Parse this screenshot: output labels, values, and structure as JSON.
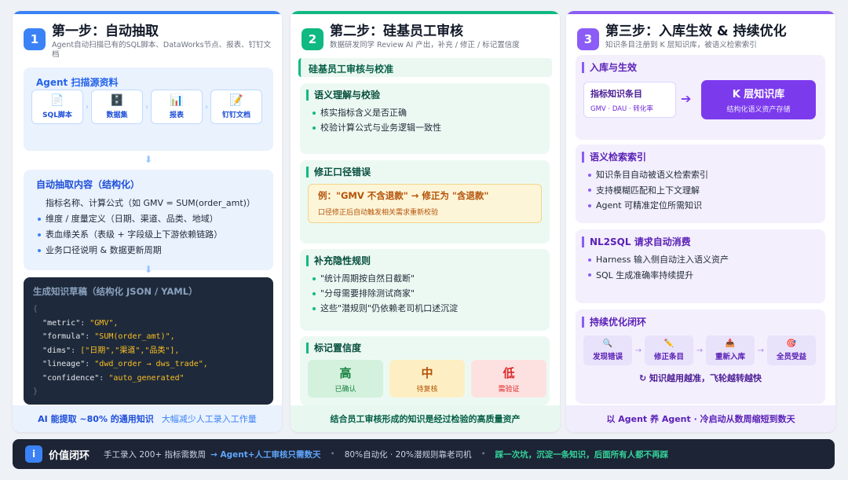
{
  "col1": {
    "num": "1",
    "title": "第一步：自动抽取",
    "subtitle": "Agent自动扫描已有的SQL脚本、DataWorks节点、报表、钉钉文档",
    "scan": {
      "title": "Agent 扫描源资料",
      "sources": [
        {
          "icon": "document-icon",
          "glyph": "📄",
          "label": "SQL脚本"
        },
        {
          "icon": "cabinet-icon",
          "glyph": "🗄️",
          "label": "数据集"
        },
        {
          "icon": "bar-chart-icon",
          "glyph": "📊",
          "label": "报表"
        },
        {
          "icon": "memo-icon",
          "glyph": "📝",
          "label": "钉钉文档"
        }
      ]
    },
    "extract": {
      "title": "自动抽取内容（结构化）",
      "items": [
        "指标名称、计算公式（如 GMV = SUM(order_amt)）",
        "维度 / 度量定义（日期、渠道、品类、地域）",
        "表血缘关系（表级 + 字段级上下游依赖链路）",
        "业务口径说明 & 数据更新周期"
      ]
    },
    "draft": {
      "title": "生成知识草稿（结构化 JSON / YAML）",
      "open_brace": "{",
      "close_brace": "}",
      "lines": [
        {
          "key": "\"metric\"",
          "value": "\"GMV\","
        },
        {
          "key": "\"formula\"",
          "value": "\"SUM(order_amt)\","
        },
        {
          "key": "\"dims\"",
          "value": "[\"日期\",\"渠道\",\"品类\"],"
        },
        {
          "key": "\"lineage\"",
          "value": "\"dwd_order → dws_trade\","
        },
        {
          "key": "\"confidence\"",
          "value": "\"auto_generated\""
        }
      ]
    },
    "footer_main": "AI 能提取 ~80% 的通用知识",
    "footer_sub": "大幅减少人工录入工作量"
  },
  "col2": {
    "num": "2",
    "title": "第二步：硅基员工审核",
    "subtitle": "数据研发同学 Review AI 产出，补充 / 修正 / 标记置信度",
    "section": "硅基员工审核与校准",
    "semantic": {
      "title": "语义理解与校验",
      "items": [
        "核实指标含义是否正确",
        "校验计算公式与业务逻辑一致性"
      ]
    },
    "fix": {
      "title": "修正口径错误",
      "example": "例：\"GMV 不含退款\" → 修正为 \"含退款\"",
      "note": "口径修正后自动触发相关需求重新校验"
    },
    "hidden": {
      "title": "补充隐性规则",
      "items": [
        "\"统计周期按自然日截断\"",
        "\"分母需要排除测试商家\"",
        "这些\"潜规则\"仍依赖老司机口述沉淀"
      ]
    },
    "confidence": {
      "title": "标记置信度",
      "levels": [
        {
          "label": "高",
          "status": "已确认",
          "color": "#15803d"
        },
        {
          "label": "中",
          "status": "待复核",
          "color": "#b45309"
        },
        {
          "label": "低",
          "status": "需验证",
          "color": "#dc2626"
        }
      ]
    },
    "footer": "结合员工审核形成的知识是经过检验的高质量资产"
  },
  "col3": {
    "num": "3",
    "title": "第三步：入库生效 & 持续优化",
    "subtitle": "知识条目注册到 K 层知识库，被语义检索索引",
    "ingest": {
      "title": "入库与生效",
      "entry_title": "指标知识条目",
      "entry_sub": "GMV · DAU · 转化率",
      "kb_title": "K 层知识库",
      "kb_sub": "结构化语义资产存储"
    },
    "search": {
      "title": "语义检索索引",
      "items": [
        "知识条目自动被语义检索索引",
        "支持模糊匹配和上下文理解",
        "Agent 可精准定位所需知识"
      ]
    },
    "nl2sql": {
      "title": "NL2SQL 请求自动消费",
      "items": [
        "Harness 输入侧自动注入语义资产",
        "SQL 生成准确率持续提升"
      ]
    },
    "loop": {
      "title": "持续优化闭环",
      "steps": [
        {
          "icon": "magnifier-icon",
          "glyph": "🔍",
          "label": "发现错误"
        },
        {
          "icon": "pencil-icon",
          "glyph": "✏️",
          "label": "修正条目"
        },
        {
          "icon": "inbox-icon",
          "glyph": "📥",
          "label": "重新入库"
        },
        {
          "icon": "target-icon",
          "glyph": "🎯",
          "label": "全员受益"
        }
      ],
      "caption": "↻ 知识越用越准，飞轮越转越快"
    },
    "footer": "以 Agent 养 Agent · 冷启动从数周缩短到数天"
  },
  "bottom": {
    "icon": "i",
    "title": "价值闭环",
    "t1": "手工录入 200+ 指标需数周",
    "t2": "→ Agent+人工审核只需数天",
    "t3": "80%自动化 · 20%潜规则靠老司机",
    "t4": "踩一次坑，沉淀一条知识，后面所有人都不再踩",
    "dot": "•"
  },
  "colors": {
    "blue": "#3b82f6",
    "green": "#10b981",
    "purple": "#8b5cf6",
    "dark": "#1c2436"
  }
}
